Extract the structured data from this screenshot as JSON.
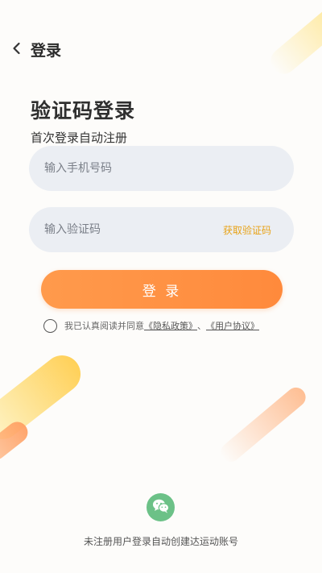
{
  "header": {
    "back_icon": "chevron-left-icon",
    "title": "登录"
  },
  "main": {
    "title": "验证码登录",
    "subtitle": "首次登录自动注册",
    "phone_field": {
      "placeholder": "输入手机号码",
      "value": ""
    },
    "code_field": {
      "placeholder": "输入验证码",
      "value": "",
      "get_code_label": "获取验证码"
    },
    "login_button_label": "登 录",
    "agreement": {
      "checked": false,
      "prefix": "我已认真阅读并同意",
      "privacy_link": "《隐私政策》",
      "separator": "、",
      "user_agreement_link": "《用户协议》"
    }
  },
  "footer": {
    "wechat_icon": "wechat-icon",
    "note": "未注册用户登录自动创建达运动账号"
  },
  "colors": {
    "accent_orange": "#ff8f42",
    "get_code_text": "#e8a317",
    "wechat_green": "#6cc187",
    "input_background": "#ebeef3"
  }
}
